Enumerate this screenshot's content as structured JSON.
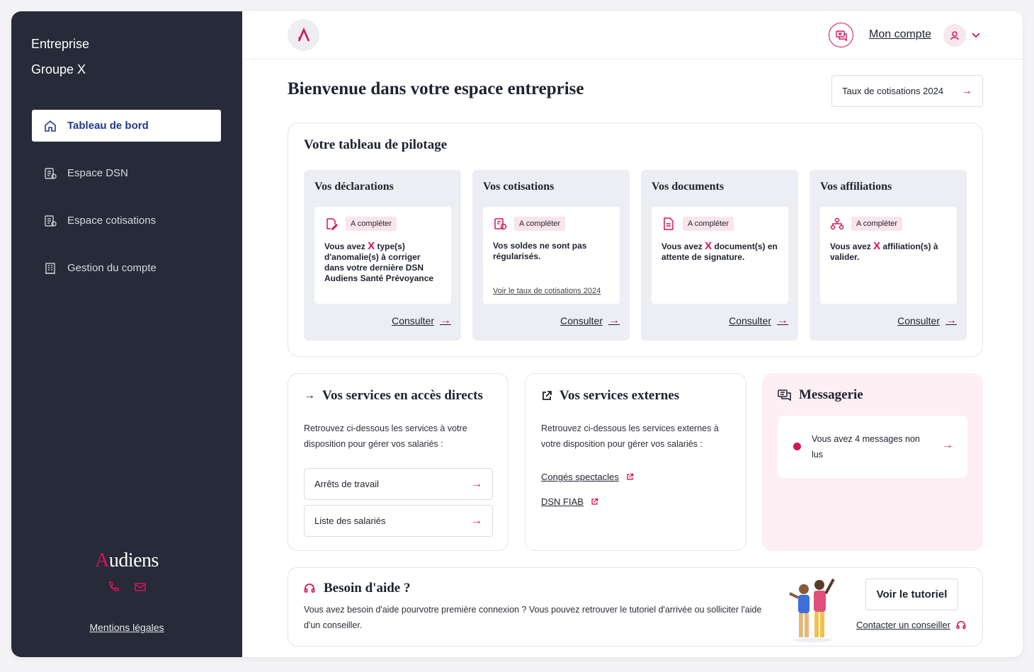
{
  "colors": {
    "accent": "#d4145a",
    "sidebar": "#272a38",
    "card": "#eceef4",
    "msg_bg": "#fdeff3"
  },
  "sidebar": {
    "company_line1": "Entreprise",
    "company_line2": "Groupe X",
    "items": [
      {
        "label": "Tableau de bord",
        "icon": "home-icon"
      },
      {
        "label": "Espace DSN",
        "icon": "document-icon"
      },
      {
        "label": "Espace cotisations",
        "icon": "document-icon"
      },
      {
        "label": "Gestion du compte",
        "icon": "building-icon"
      }
    ],
    "brand": "udiens",
    "brand_initial": "A",
    "legal": "Mentions légales"
  },
  "header": {
    "account": "Mon compte"
  },
  "main": {
    "title": "Bienvenue dans votre espace entreprise",
    "rate_button": "Taux de cotisations 2024",
    "pilot": {
      "title": "Votre tableau de pilotage",
      "badge": "A compléter",
      "consult": "Consulter",
      "cards": [
        {
          "title": "Vos déclarations",
          "text_a": "Vous avez ",
          "x": "X",
          "text_b": " type(s) d'anomalie(s) à corriger dans votre dernière DSN Audiens Santé Prévoyance"
        },
        {
          "title": "Vos cotisations",
          "text": "Vos soldes ne sont pas régularisés.",
          "link": "Voir le taux de cotisations 2024"
        },
        {
          "title": "Vos documents",
          "text_a": "Vous avez ",
          "x": "X",
          "text_b": " document(s) en attente de signature."
        },
        {
          "title": "Vos affiliations",
          "text_a": "Vous avez ",
          "x": "X",
          "text_b": " affiliation(s) à valider."
        }
      ]
    },
    "direct": {
      "title": "Vos services en accès directs",
      "desc": "Retrouvez ci-dessous les services à votre disposition pour gérer vos salariés :",
      "buttons": [
        "Arrêts de travail",
        "Liste des salariés"
      ]
    },
    "external": {
      "title": "Vos services externes",
      "desc": "Retrouvez ci-dessous les services externes à votre disposition pour gérer vos salariés :",
      "links": [
        "Congés spectacles",
        "DSN FIAB"
      ]
    },
    "messaging": {
      "title": "Messagerie",
      "text": "Vous avez 4 messages non lus"
    },
    "help": {
      "title": "Besoin d'aide ?",
      "text": "Vous avez besoin d'aide pourvotre première connexion ? Vous pouvez retrouver le tutoriel d'arrivée ou solliciter l'aide d'un conseiller.",
      "tutorial": "Voir le tutoriel",
      "contact": "Contacter un conseiller"
    },
    "arrow": "→"
  }
}
